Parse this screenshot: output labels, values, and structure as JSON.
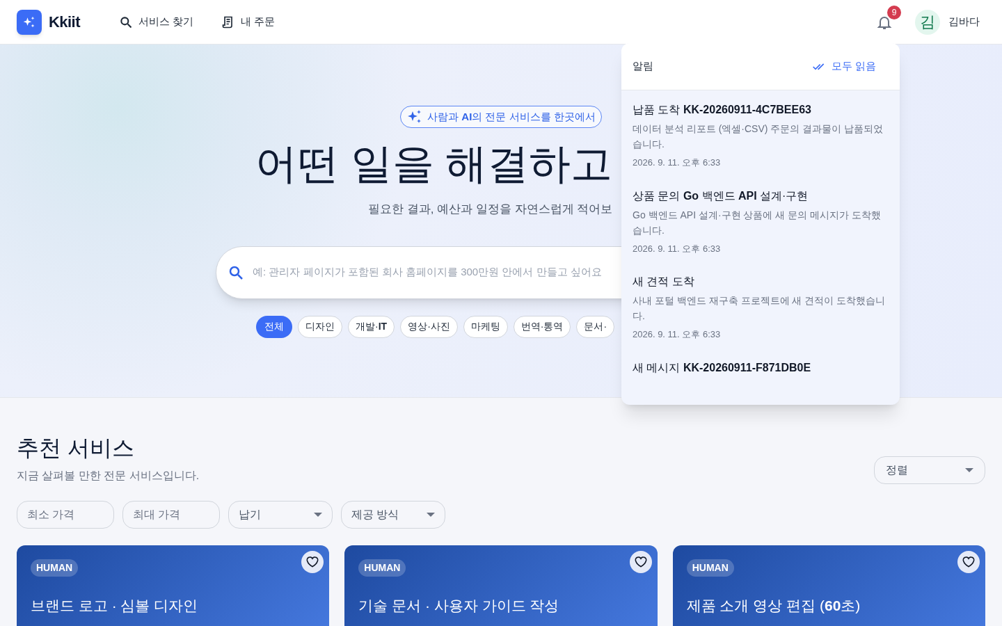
{
  "header": {
    "logo": "Kkiit",
    "nav": [
      {
        "label": "서비스 찾기"
      },
      {
        "label": "내 주문"
      }
    ],
    "notification_count": "9",
    "user": {
      "initial": "김",
      "name": "김바다"
    }
  },
  "hero": {
    "badge": "사람과 **AI**의 전문 서비스를 한곳에서",
    "heading": "어떤 일을 해결하고",
    "subtitle": "필요한 결과, 예산과 일정을 자연스럽게 적어보",
    "search": {
      "placeholder": "예: 관리자 페이지가 포함된 회사 홈페이지를 300만원 안에서 만들고 싶어요"
    },
    "categories": [
      {
        "label": "전체",
        "selected": true
      },
      {
        "label": "디자인",
        "selected": false
      },
      {
        "label": "개발·**IT**",
        "selected": false
      },
      {
        "label": "영상·사진",
        "selected": false
      },
      {
        "label": "마케팅",
        "selected": false
      },
      {
        "label": "번역·통역",
        "selected": false
      },
      {
        "label": "문서·",
        "selected": false
      }
    ]
  },
  "notifications": {
    "title": "알림",
    "mark_all": "모두 읽음",
    "items": [
      {
        "title": "납품 도착 **KK-20260911-4C7BEE63**",
        "body": "데이터 분석 리포트 (엑셀·CSV) 주문의 결과물이 납품되었습니다.",
        "time": "2026. 9. 11. 오후 6:33"
      },
      {
        "title": "상품 문의 **Go** 백엔드 **API** 설계·구현",
        "body": "Go 백엔드 API 설계·구현 상품에 새 문의 메시지가 도착했습니다.",
        "time": "2026. 9. 11. 오후 6:33"
      },
      {
        "title": "새 견적 도착",
        "body": "사내 포털 백엔드 재구축 프로젝트에 새 견적이 도착했습니다.",
        "time": "2026. 9. 11. 오후 6:33"
      },
      {
        "title": "새 메시지 **KK-20260911-F871DB0E**"
      }
    ]
  },
  "section": {
    "title": "추천 서비스",
    "subtitle": "지금 살펴볼 만한 전문 서비스입니다.",
    "sort": "정렬",
    "filters": [
      {
        "kind": "input",
        "placeholder": "최소 가격"
      },
      {
        "kind": "input",
        "placeholder": "최대 가격"
      },
      {
        "kind": "select",
        "label": "납기"
      },
      {
        "kind": "select",
        "label": "제공 방식"
      }
    ],
    "cards": [
      {
        "tag": "HUMAN",
        "title": "브랜드 로고 · 심볼 디자인",
        "favorite": false
      },
      {
        "tag": "HUMAN",
        "title": "기술 문서 · 사용자 가이드 작성",
        "favorite": false
      },
      {
        "tag": "HUMAN",
        "title": "제품 소개 영상 편집 (**60**초)",
        "favorite": false
      }
    ]
  }
}
